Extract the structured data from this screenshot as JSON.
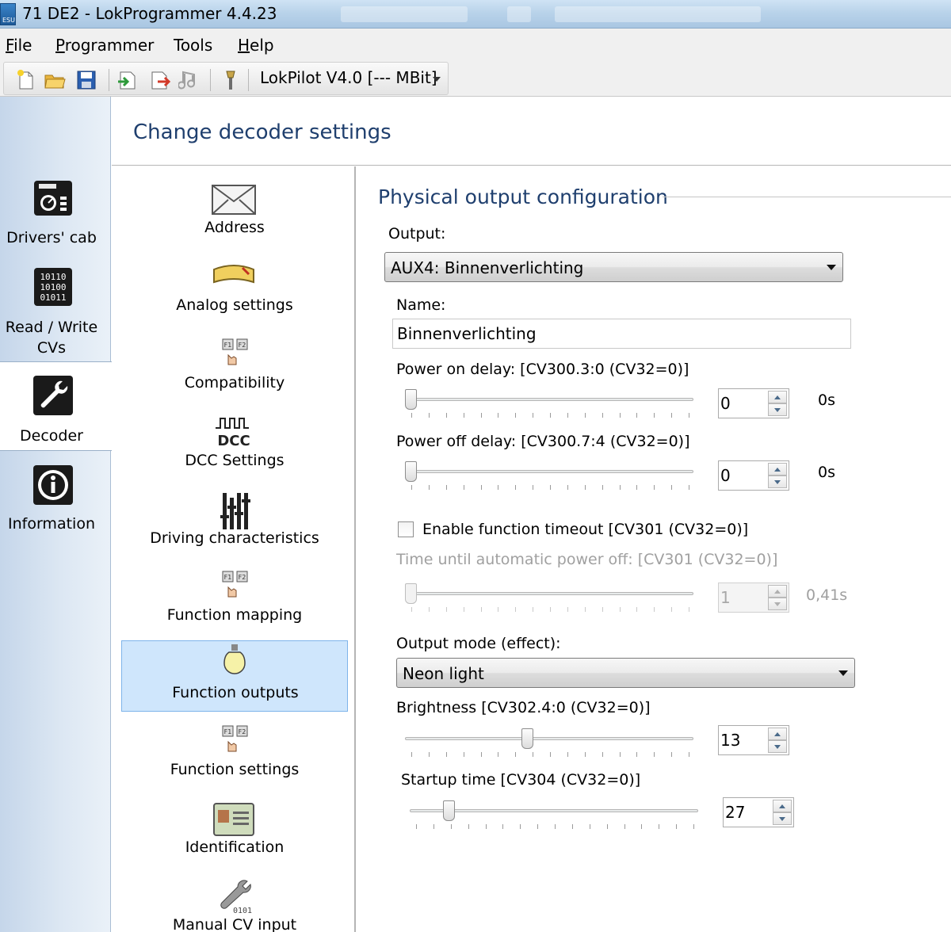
{
  "window": {
    "title": "71 DE2 - LokProgrammer 4.4.23",
    "app_icon_text": "ESU"
  },
  "menu": [
    {
      "prefix": "",
      "ul": "F",
      "rest": "ile"
    },
    {
      "prefix": "",
      "ul": "P",
      "rest": "rogrammer"
    },
    {
      "prefix": "Tools",
      "ul": "",
      "rest": ""
    },
    {
      "prefix": "",
      "ul": "H",
      "rest": "elp"
    }
  ],
  "toolbar": {
    "buttons": [
      "new-file-icon",
      "open-folder-icon",
      "save-icon",
      "import-icon",
      "export-icon",
      "sound-icon",
      "tools-icon"
    ],
    "device_selector": "LokPilot V4.0 [--- MBit]"
  },
  "leftnav": {
    "items": [
      {
        "label_lines": [
          "Drivers' cab"
        ],
        "icon": "drivers-cab-icon"
      },
      {
        "label_lines": [
          "Read / Write",
          "CVs"
        ],
        "icon": "read-write-cvs-icon"
      },
      {
        "label_lines": [
          "Decoder"
        ],
        "icon": "wrench-icon",
        "active": true
      },
      {
        "label_lines": [
          "Information"
        ],
        "icon": "information-icon"
      }
    ]
  },
  "page_title": "Change decoder settings",
  "categories": [
    {
      "label": "Address",
      "icon": "envelope-icon"
    },
    {
      "label": "Analog settings",
      "icon": "gauge-icon"
    },
    {
      "label": "Compatibility",
      "icon": "function-keys-icon"
    },
    {
      "label": "DCC Settings",
      "icon": "dcc-icon",
      "icon_text": "DCC"
    },
    {
      "label": "Driving characteristics",
      "icon": "sliders-icon"
    },
    {
      "label": "Function mapping",
      "icon": "function-keys-icon"
    },
    {
      "label": "Function outputs",
      "icon": "light-bulb-icon",
      "selected": true
    },
    {
      "label": "Function settings",
      "icon": "function-keys-icon"
    },
    {
      "label": "Identification",
      "icon": "id-card-icon"
    },
    {
      "label": "Manual CV input",
      "icon": "wrench-bits-icon",
      "icon_text": "0101"
    }
  ],
  "config": {
    "section_title": "Physical output configuration",
    "output_label": "Output:",
    "output_value": "AUX4: Binnenverlichting",
    "name_label": "Name:",
    "name_value": "Binnenverlichting",
    "power_on": {
      "label": "Power on delay: [CV300.3:0 (CV32=0)]",
      "value": "0",
      "unit_text": "0s",
      "fraction": 0
    },
    "power_off": {
      "label": "Power off delay: [CV300.7:4 (CV32=0)]",
      "value": "0",
      "unit_text": "0s",
      "fraction": 0
    },
    "timeout_checkbox_label": "Enable function timeout [CV301 (CV32=0)]",
    "timeout_checked": false,
    "auto_off": {
      "label": "Time until automatic power off: [CV301 (CV32=0)]",
      "value": "1",
      "unit_text": "0,41s",
      "fraction": 0,
      "disabled": true
    },
    "mode_label": "Output mode (effect):",
    "mode_value": "Neon light",
    "brightness": {
      "label": "Brightness [CV302.4:0 (CV32=0)]",
      "value": "13",
      "fraction": 0.42
    },
    "startup": {
      "label": "Startup time [CV304 (CV32=0)]",
      "value": "27",
      "fraction": 0.12
    }
  },
  "colors": {
    "accent_title": "#1f3f6e",
    "selection_bg": "#cfe6fc",
    "selection_border": "#7eb4ea"
  }
}
